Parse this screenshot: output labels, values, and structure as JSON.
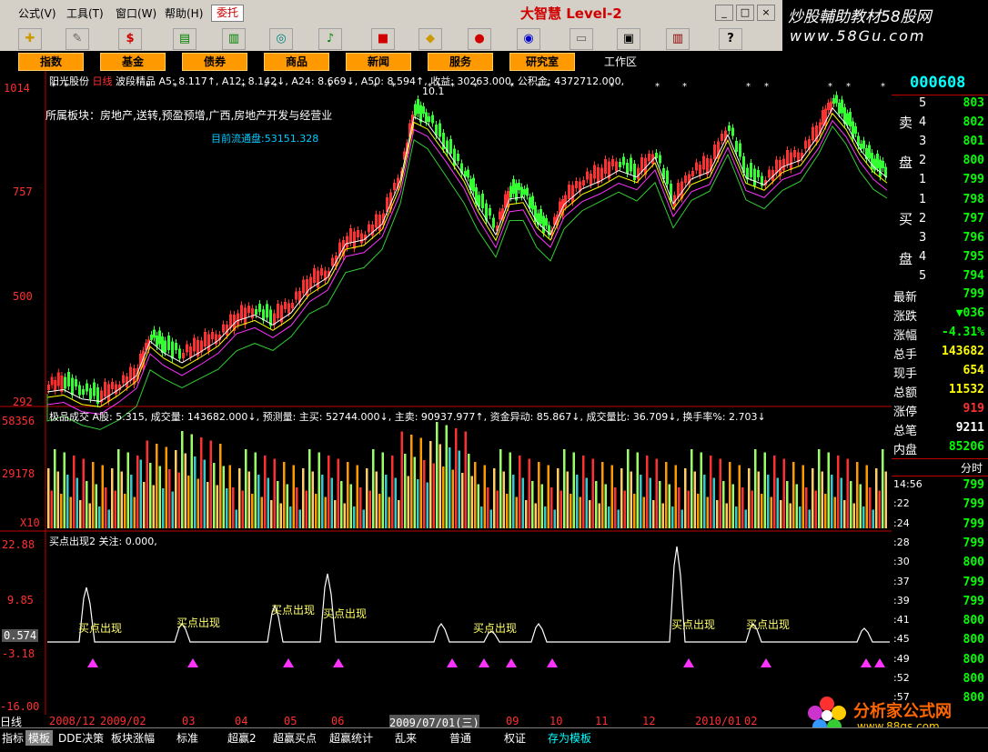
{
  "menu": [
    "公式(V)",
    "工具(T)",
    "窗口(W)",
    "帮助(H)"
  ],
  "alert_button": "委托",
  "brand": "大智慧 Level-2",
  "site_title": "炒股輔助教材58股网",
  "site_url": "www.58Gu.com",
  "nav": [
    "指数",
    "基金",
    "债券",
    "商品",
    "新闻",
    "服务",
    "研究室"
  ],
  "workspace": "工作区",
  "stock": {
    "name": "阳光股份",
    "period": "日线",
    "indicator": "波段精品",
    "info_line": "A5: 8.117↑, A12: 8.142↓, A24: 8.669↓, A50: 8.594↑, 收益: 30263.000, 公积金: 4372712.000,",
    "sector": "所属板块：房地产,送转,预盈预增,广西,房地产开发与经营业",
    "float_shares": "目前流通盘:53151.328",
    "peak_label": "10.1"
  },
  "price_axis": [
    "1014",
    "757",
    "500",
    "292"
  ],
  "volume": {
    "line": "极品成交 A股: 5.315, 成交量: 143682.000↓, 预测量: 主买: 52744.000↓, 主卖: 90937.977↑, 资金异动: 85.867↓, 成交量比: 36.709↓, 换手率%: 2.703↓",
    "axis": [
      "58356",
      "29178",
      "X10"
    ]
  },
  "signal": {
    "line": "买点出现2 关注: 0.000,",
    "axis": [
      "22.88",
      "9.85",
      "0.574",
      "-3.18",
      "-16.00"
    ],
    "labels": [
      "买点出现",
      "买点出现",
      "买点出现",
      "买点出现",
      "买点出现",
      "买点出现",
      "买点出现"
    ]
  },
  "dates": [
    "2008/12",
    "2009/02",
    "03",
    "04",
    "05",
    "06",
    "2009/07/01(三)",
    "09",
    "10",
    "11",
    "12",
    "2010/01",
    "02"
  ],
  "right_panel": {
    "code": "000608",
    "sell_label_1": "卖",
    "sell_label_2": "盘",
    "buy_label_1": "买",
    "buy_label_2": "盘",
    "sell": [
      {
        "lvl": "5",
        "price": "803"
      },
      {
        "lvl": "4",
        "price": "802"
      },
      {
        "lvl": "3",
        "price": "801"
      },
      {
        "lvl": "2",
        "price": "800"
      },
      {
        "lvl": "1",
        "price": "799"
      }
    ],
    "buy": [
      {
        "lvl": "1",
        "price": "798"
      },
      {
        "lvl": "2",
        "price": "797"
      },
      {
        "lvl": "3",
        "price": "796"
      },
      {
        "lvl": "4",
        "price": "795"
      },
      {
        "lvl": "5",
        "price": "794"
      }
    ],
    "stats": [
      {
        "label": "最新",
        "value": "799",
        "color": "#00ff00"
      },
      {
        "label": "涨跌",
        "value": "▼036",
        "color": "#00ff00"
      },
      {
        "label": "涨幅",
        "value": "-4.31%",
        "color": "#00ff00"
      },
      {
        "label": "总手",
        "value": "143682",
        "color": "#ffff00"
      },
      {
        "label": "现手",
        "value": "654",
        "color": "#ffff00"
      },
      {
        "label": "总额",
        "value": "11532",
        "color": "#ffff00"
      },
      {
        "label": "涨停",
        "value": "919",
        "color": "#ff3030"
      },
      {
        "label": "总笔",
        "value": "9211",
        "color": "#ffffff"
      },
      {
        "label": "内盘",
        "value": "85206",
        "color": "#00ff00"
      }
    ],
    "tick_header": "分时",
    "ticks": [
      {
        "t": "14:56",
        "p": "799"
      },
      {
        "t": ":22",
        "p": "799"
      },
      {
        "t": ":24",
        "p": "799"
      },
      {
        "t": ":28",
        "p": "799"
      },
      {
        "t": ":30",
        "p": "800"
      },
      {
        "t": ":37",
        "p": "799"
      },
      {
        "t": ":39",
        "p": "799"
      },
      {
        "t": ":41",
        "p": "800"
      },
      {
        "t": ":45",
        "p": "800"
      },
      {
        "t": ":49",
        "p": "800"
      },
      {
        "t": ":52",
        "p": "800"
      },
      {
        "t": ":57",
        "p": "800"
      }
    ]
  },
  "bottom_tabs": [
    "指标",
    "模板",
    "DDE决策",
    "板块涨幅",
    "标准",
    "超赢2",
    "超赢买点",
    "超赢统计",
    "乱来",
    "普通",
    "权证",
    "存为模板"
  ],
  "bottom_period": "日线",
  "watermark_title": "分析家公式网",
  "watermark_url": "www.88gs.com"
}
